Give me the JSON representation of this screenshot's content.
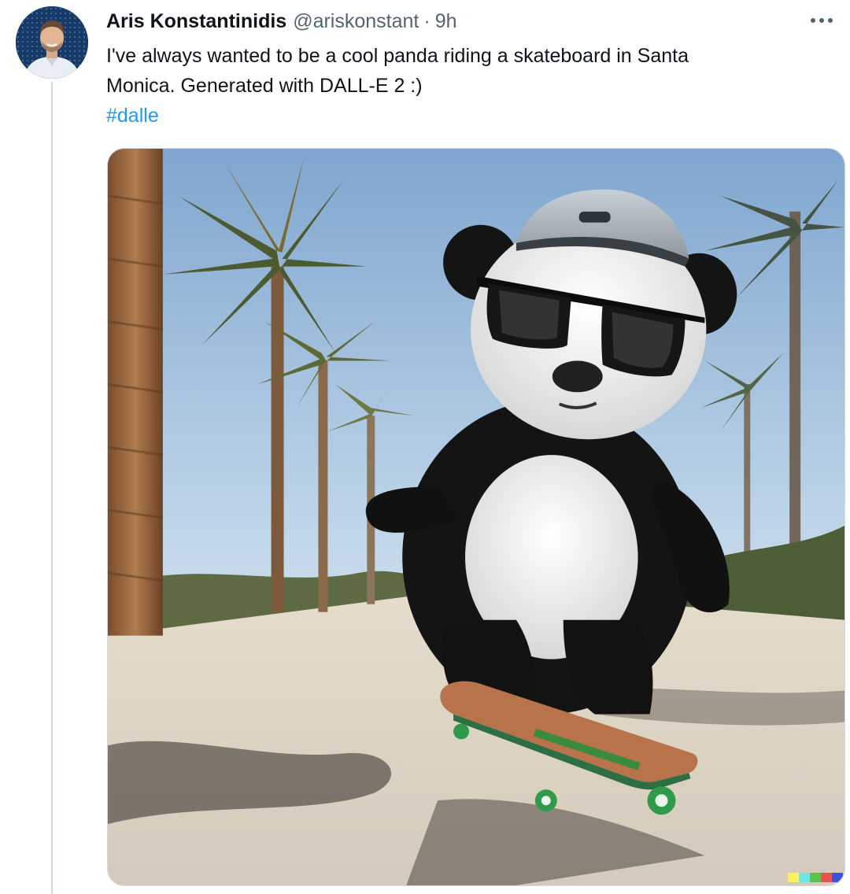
{
  "tweet": {
    "author": {
      "display_name": "Aris Konstantinidis",
      "handle": "@ariskonstant"
    },
    "separator": "·",
    "timestamp": "9h",
    "text_line1": "I've always wanted to be a cool panda riding a skateboard in Santa",
    "text_line2": "Monica. Generated with DALL-E 2 :)",
    "hashtag": "#dalle",
    "more_icon": "more-horizontal-icon",
    "media": {
      "alt": "AI generated image of a panda wearing sunglasses and a cap riding a skateboard on a palm-lined street",
      "watermark_colors": [
        "#fdf05e",
        "#6ee6e6",
        "#58c447",
        "#e8524d",
        "#3b53d6"
      ]
    }
  },
  "colors": {
    "text_primary": "#0f1419",
    "text_secondary": "#536471",
    "link": "#1d9bf0",
    "thread_line": "#cfd9de"
  }
}
